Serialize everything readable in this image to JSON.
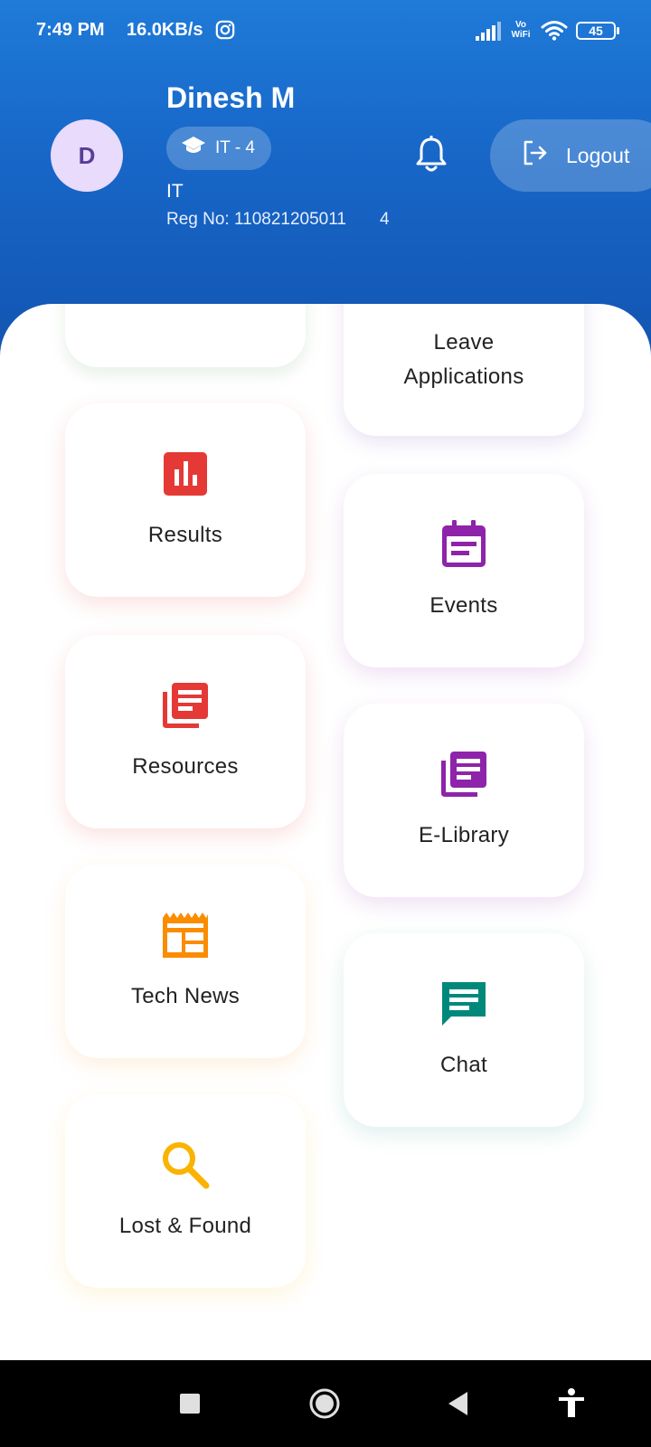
{
  "status_bar": {
    "time": "7:49 PM",
    "net_speed": "16.0KB/s",
    "vowifi_line1": "Vo",
    "vowifi_line2": "WiFi",
    "battery": "45"
  },
  "profile": {
    "avatar_initial": "D",
    "name": "Dinesh M",
    "class_chip": "IT - 4",
    "department": "IT",
    "reg_no": "Reg No: 110821205011",
    "semester": "4"
  },
  "header_actions": {
    "logout_label": "Logout"
  },
  "menu": {
    "left": [
      {
        "label": "",
        "icon": "partial-card"
      },
      {
        "label": "Results",
        "icon": "bar-chart-icon",
        "color": "#E53935"
      },
      {
        "label": "Resources",
        "icon": "library-books-icon",
        "color": "#E53935"
      },
      {
        "label": "Tech News",
        "icon": "newspaper-icon",
        "color": "#FB8C00"
      },
      {
        "label": "Lost & Found",
        "icon": "search-icon",
        "color": "#F9B300"
      }
    ],
    "right": [
      {
        "label": "Leave\nApplications",
        "label_line1": "Leave",
        "label_line2": "Applications",
        "icon": "none"
      },
      {
        "label": "Events",
        "icon": "event-note-icon",
        "color": "#8E24AA"
      },
      {
        "label": "E-Library",
        "icon": "library-books-icon",
        "color": "#8E24AA"
      },
      {
        "label": "Chat",
        "icon": "chat-icon",
        "color": "#00897B"
      }
    ]
  },
  "colors": {
    "header_top": "#1f7ad8",
    "header_bottom": "#1354b1",
    "avatar_bg": "#e8dbfb"
  }
}
